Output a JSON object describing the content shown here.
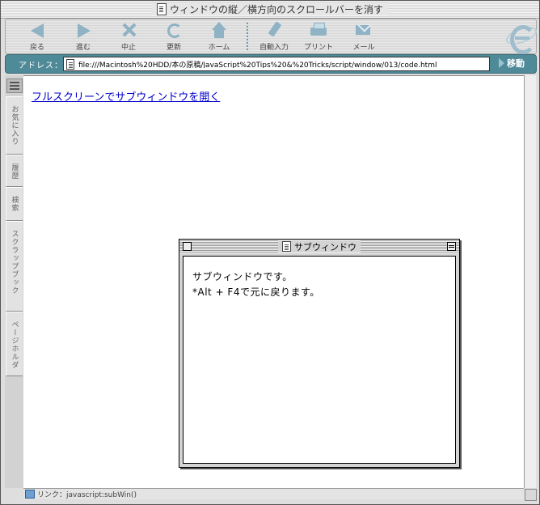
{
  "window": {
    "title": "ウィンドウの縦／横方向のスクロールバーを消す"
  },
  "toolbar": {
    "buttons": [
      {
        "label": "戻る",
        "icon": "back-arrow-icon"
      },
      {
        "label": "進む",
        "icon": "forward-arrow-icon"
      },
      {
        "label": "中止",
        "icon": "stop-icon"
      },
      {
        "label": "更新",
        "icon": "refresh-icon"
      },
      {
        "label": "ホーム",
        "icon": "home-icon"
      },
      {
        "label": "自動入力",
        "icon": "autofill-icon"
      },
      {
        "label": "プリント",
        "icon": "print-icon"
      },
      {
        "label": "メール",
        "icon": "mail-icon"
      }
    ]
  },
  "address": {
    "label": "アドレス：",
    "url": "file:///Macintosh%20HDD/本の原稿/JavaScript%20Tips%20&%20Tricks/script/window/013/code.html",
    "go_label": "移動"
  },
  "sidebar": {
    "tabs": [
      "お気に入り",
      "履歴",
      "検索",
      "スクラップブック",
      "ページホルダ"
    ]
  },
  "content": {
    "link_text": "フルスクリーンでサブウィンドウを開く"
  },
  "status": {
    "text": "リンク：javascript:subWin()"
  },
  "subwindow": {
    "title": "サブウィンドウ",
    "lines": [
      "サブウィンドウです。",
      "*Alt + F4で元に戻ります。"
    ]
  },
  "colors": {
    "address_bar": "#4f8a98",
    "link": "#0000cc",
    "icon_tint": "#8fb2c4"
  }
}
